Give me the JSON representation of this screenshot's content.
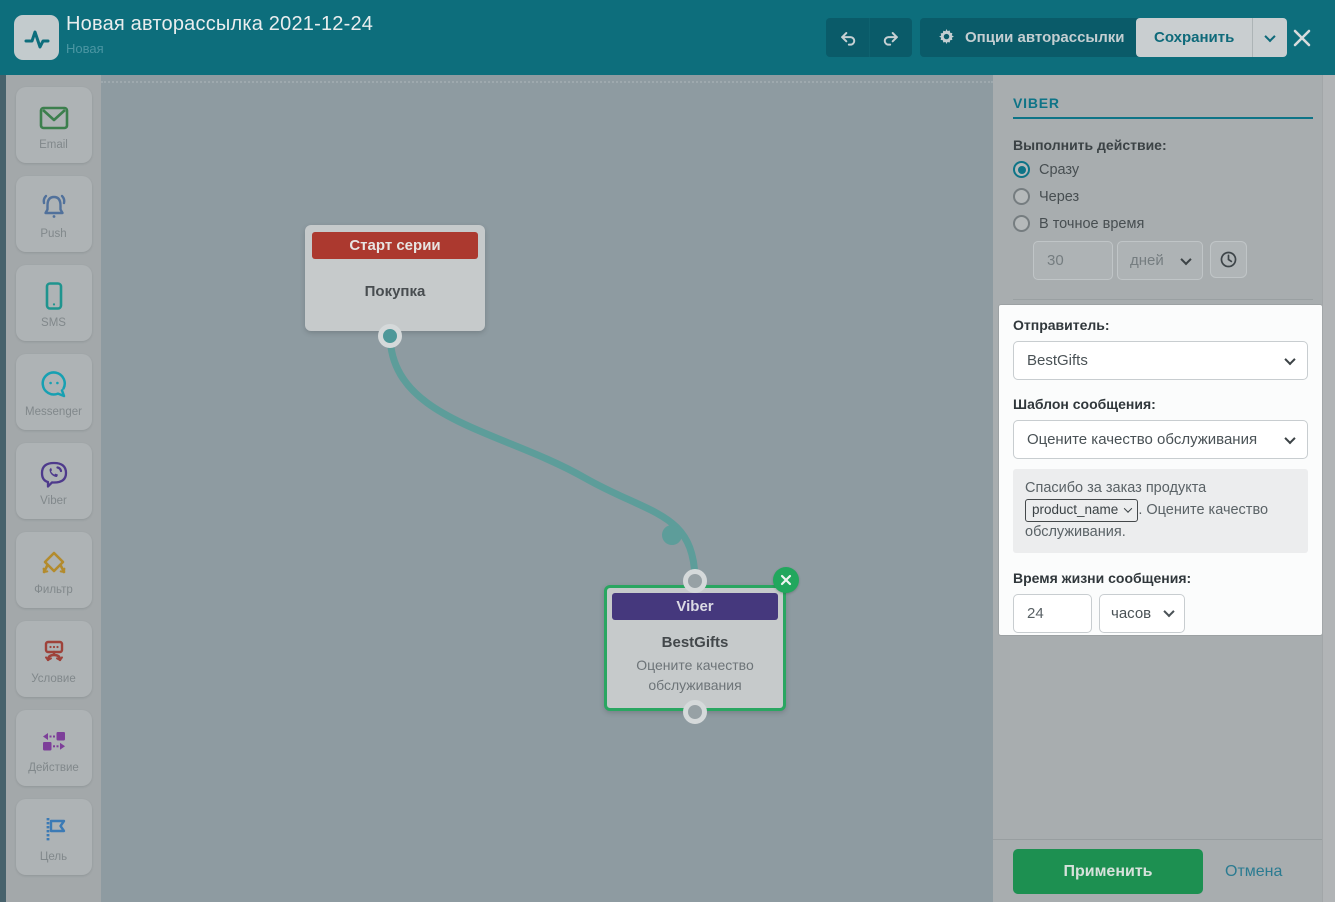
{
  "header": {
    "title": "Новая авторассылка 2021-12-24",
    "subtitle": "Новая",
    "options_button_label": "Опции авторассылки",
    "save_button_label": "Сохранить",
    "header_color": "#0d6e7c"
  },
  "sidebar": {
    "items": [
      {
        "label": "Email",
        "icon": "email-icon",
        "color": "#3c7f4d"
      },
      {
        "label": "Push",
        "icon": "push-bell-icon",
        "color": "#51719b"
      },
      {
        "label": "SMS",
        "icon": "sms-phone-icon",
        "color": "#1f948e"
      },
      {
        "label": "Messenger",
        "icon": "messenger-chat-icon",
        "color": "#17a0b2"
      },
      {
        "label": "Viber",
        "icon": "viber-bubble-icon",
        "color": "#4e3a8c"
      },
      {
        "label": "Фильтр",
        "icon": "filter-diamond-icon",
        "color": "#b38b2d"
      },
      {
        "label": "Условие",
        "icon": "condition-branch-icon",
        "color": "#9e423a"
      },
      {
        "label": "Действие",
        "icon": "action-arrows-icon",
        "color": "#7d3f99"
      },
      {
        "label": "Цель",
        "icon": "goal-flag-icon",
        "color": "#3b7ab5"
      }
    ]
  },
  "canvas": {
    "start_node": {
      "header": "Старт серии",
      "body": "Покупка",
      "header_color": "#ac392f"
    },
    "viber_node": {
      "header": "Viber",
      "title": "BestGifts",
      "subtitle": "Оцените качество обслуживания",
      "header_color": "#45387d",
      "selected_border_color": "#2aa661"
    },
    "connector_color": "#5d9d9a"
  },
  "panel": {
    "heading": "VIBER",
    "action_label": "Выполнить действие:",
    "radios": [
      {
        "label": "Сразу",
        "selected": true
      },
      {
        "label": "Через",
        "selected": false
      },
      {
        "label": "В точное время",
        "selected": false
      }
    ],
    "delay_value": "30",
    "delay_unit": "дней",
    "sender_label": "Отправитель:",
    "sender_value": "BestGifts",
    "template_label": "Шаблон сообщения:",
    "template_value": "Оцените качество обслуживания",
    "preview_text_before": "Спасибо за заказ продукта",
    "preview_variable": "product_name",
    "preview_text_after": ". Оцените качество обслуживания.",
    "ttl_label": "Время жизни сообщения:",
    "ttl_value": "24",
    "ttl_unit": "часов",
    "apply_label": "Применить",
    "cancel_label": "Отмена",
    "accent_color": "#0e7487",
    "apply_color": "#1d9051"
  }
}
